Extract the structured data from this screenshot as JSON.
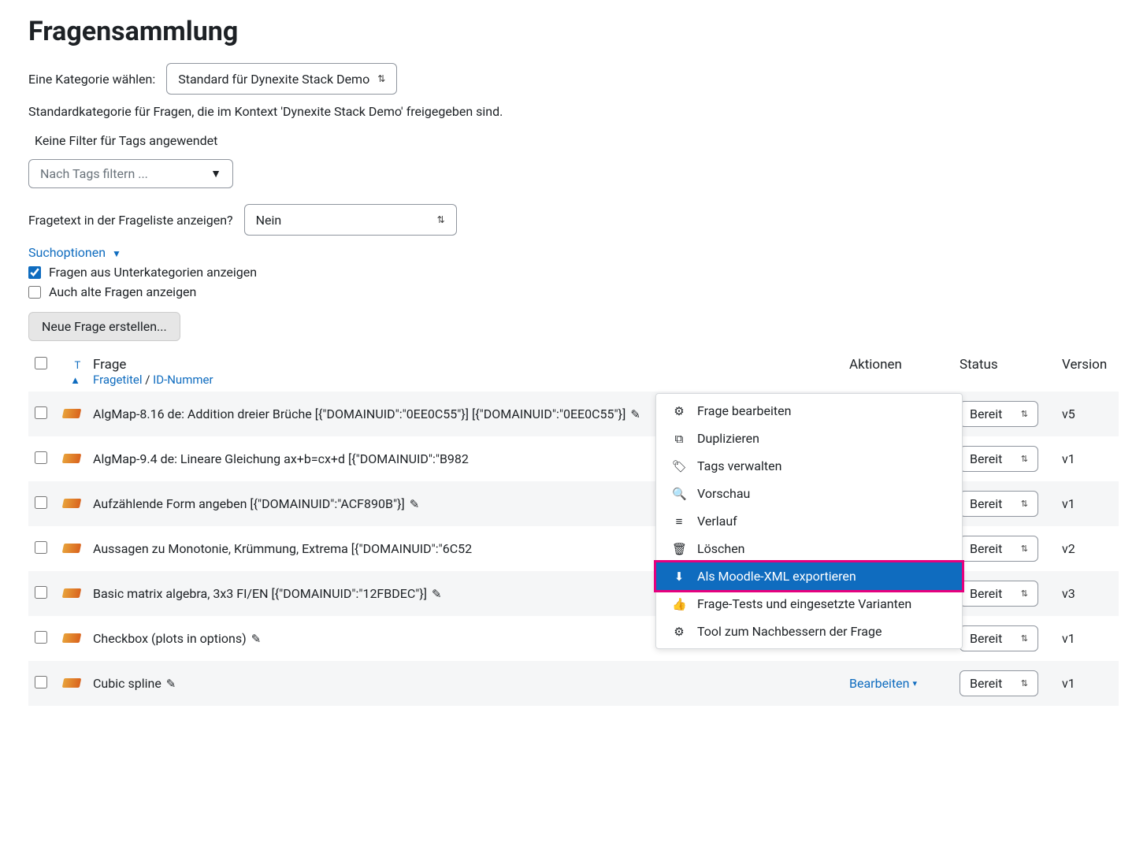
{
  "title": "Fragensammlung",
  "category_label": "Eine Kategorie wählen:",
  "category_value": "Standard für Dynexite Stack Demo",
  "category_desc": "Standardkategorie für Fragen, die im Kontext 'Dynexite Stack Demo' freigegeben sind.",
  "tagfilter_empty": "Keine Filter für Tags angewendet",
  "tagfilter_placeholder": "Nach Tags filtern ...",
  "showtext_label": "Fragetext in der Frageliste anzeigen?",
  "showtext_value": "Nein",
  "searchoptions": "Suchoptionen",
  "chk_subcat": "Fragen aus Unterkategorien anzeigen",
  "chk_old": "Auch alte Fragen anzeigen",
  "btn_new": "Neue Frage erstellen...",
  "col_sort": "T",
  "col_question": "Frage",
  "col_sub_title": "Fragetitel",
  "col_sub_id": "ID-Nummer",
  "col_actions": "Aktionen",
  "col_status": "Status",
  "col_version": "Version",
  "edit_label": "Bearbeiten",
  "rows": [
    {
      "title": "AlgMap-8.16 de: Addition dreier Brüche [{\"DOMAINUID\":\"0EE0C55\"}] [{\"DOMAINUID\":\"0EE0C55\"}]",
      "status": "Bereit",
      "version": "v5",
      "highlight": true,
      "pencil": true
    },
    {
      "title": "AlgMap-9.4 de: Lineare Gleichung ax+b=cx+d [{\"DOMAINUID\":\"B982",
      "status": "Bereit",
      "version": "v1",
      "pencil": false
    },
    {
      "title": "Aufzählende Form angeben [{\"DOMAINUID\":\"ACF890B\"}]",
      "status": "Bereit",
      "version": "v1",
      "pencil": true
    },
    {
      "title": "Aussagen zu Monotonie, Krümmung, Extrema [{\"DOMAINUID\":\"6C52",
      "status": "Bereit",
      "version": "v2",
      "pencil": false
    },
    {
      "title": "Basic matrix algebra, 3x3 FI/EN [{\"DOMAINUID\":\"12FBDEC\"}]",
      "status": "Bereit",
      "version": "v3",
      "pencil": true
    },
    {
      "title": "Checkbox (plots in options)",
      "status": "Bereit",
      "version": "v1",
      "pencil": true
    },
    {
      "title": "Cubic spline",
      "status": "Bereit",
      "version": "v1",
      "pencil": true,
      "show_edit": true
    }
  ],
  "menu": [
    {
      "icon": "⚙",
      "label": "Frage bearbeiten"
    },
    {
      "icon": "⧉",
      "label": "Duplizieren"
    },
    {
      "icon": "🏷",
      "label": "Tags verwalten"
    },
    {
      "icon": "🔍",
      "label": "Vorschau"
    },
    {
      "icon": "≡",
      "label": "Verlauf"
    },
    {
      "icon": "🗑",
      "label": "Löschen"
    },
    {
      "icon": "⬇",
      "label": "Als Moodle-XML exportieren",
      "highlighted": true
    },
    {
      "icon": "👍",
      "label": "Frage-Tests und eingesetzte Varianten"
    },
    {
      "icon": "⚙",
      "label": "Tool zum Nachbessern der Frage"
    }
  ]
}
